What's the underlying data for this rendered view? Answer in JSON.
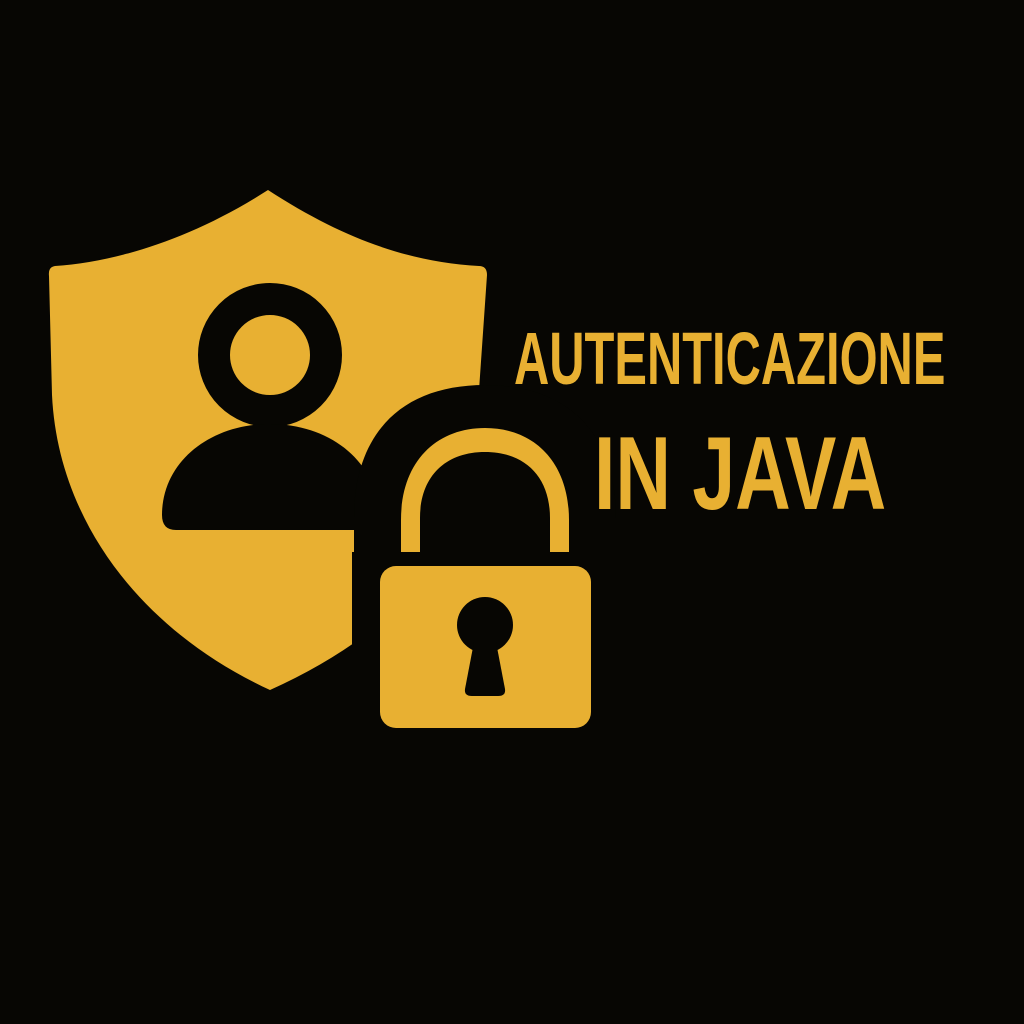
{
  "logo": {
    "title_line_1": "AUTENTICAZIONE",
    "title_line_2": "IN JAVA",
    "icons": [
      "shield-icon",
      "user-icon",
      "padlock-icon",
      "keyhole-icon"
    ],
    "colors": {
      "background": "#070603",
      "accent": "#e8b032"
    }
  }
}
